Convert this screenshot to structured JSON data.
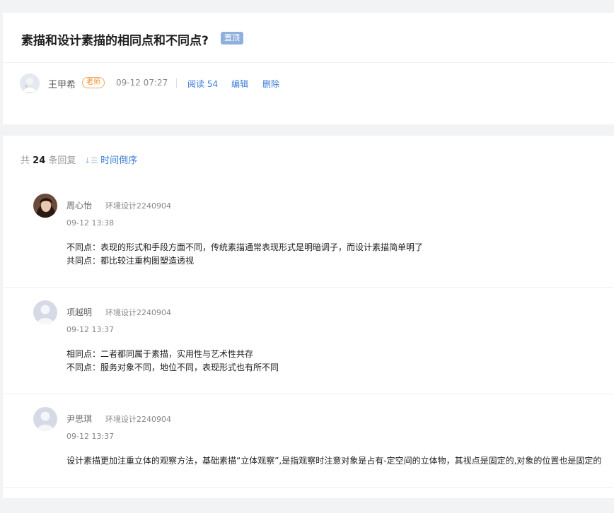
{
  "post": {
    "title": "素描和设计素描的相同点和不同点?",
    "pin_label": "置顶",
    "author": "王甲希",
    "author_role": "老师",
    "time": "09-12 07:27",
    "read_label": "阅读 54",
    "edit_label": "编辑",
    "delete_label": "删除"
  },
  "replies_header": {
    "prefix": "共",
    "count": "24",
    "suffix": "条回复",
    "sort_label": "时间倒序",
    "sort_icon": "sort-descending-icon"
  },
  "replies": [
    {
      "name": "周心怡",
      "class": "环境设计2240904",
      "time": "09-12 13:38",
      "lines": [
        "不同点：表现的形式和手段方面不同，传统素描通常表现形式是明暗调子，而设计素描简单明了",
        "共同点：都比较注重构图塑造透视"
      ]
    },
    {
      "name": "项越明",
      "class": "环境设计2240904",
      "time": "09-12 13:37",
      "lines": [
        "相同点：二者都同属于素描，实用性与艺术性共存",
        "不同点：服务对象不同，地位不同，表现形式也有所不同"
      ]
    },
    {
      "name": "尹思琪",
      "class": "环境设计2240904",
      "time": "09-12 13:37",
      "lines": [
        "设计素描更加注重立体的观察方法，基础素描“立体观察”,是指观察时注意对象是占有-定空间的立体物，其视点是固定的,对象的位置也是固定的"
      ]
    }
  ],
  "colors": {
    "accent": "#3a7bd5",
    "pin_badge": "#8fb0de",
    "teacher_badge": "#f08a24",
    "background": "#f2f3f5"
  }
}
